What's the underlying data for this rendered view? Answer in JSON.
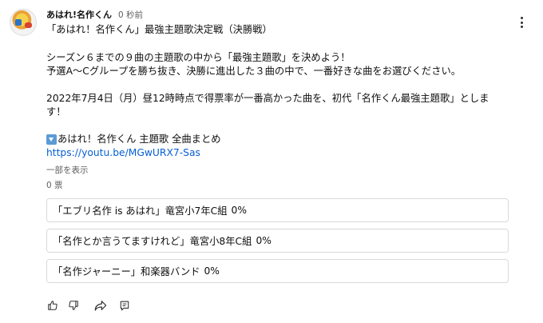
{
  "post": {
    "channel": "あはれ!名作くん",
    "time": "0 秒前",
    "title": "「あはれ！名作くん」最強主題歌決定戦（決勝戦）",
    "line1": "シーズン６までの９曲の主題歌の中から「最強主題歌」を決めよう！",
    "line2": "予選A〜Cグループを勝ち抜き、決勝に進出した３曲の中で、一番好きな曲をお選びください。",
    "line3": "2022年7月4日（月）昼12時時点で得票率が一番高かった曲を、初代「名作くん最強主題歌」としま",
    "line4": "す！",
    "line5": "あはれ！名作くん 主題歌 全曲まとめ",
    "link": "https://youtu.be/MGwURX7-Sas",
    "show_more": "一部を表示",
    "votes": "0 票"
  },
  "poll": {
    "options": [
      {
        "label": "「エブリ名作 is あはれ」竜宮小7年C組",
        "percent": "0%"
      },
      {
        "label": "「名作とか言うてますけれど」竜宮小8年C組",
        "percent": "0%"
      },
      {
        "label": "「名作ジャーニー」和楽器バンド",
        "percent": "0%"
      }
    ]
  },
  "icons": {
    "avatar": "channel-avatar",
    "more": "more-vertical-icon",
    "down_arrow": "down-arrow-emoji-icon",
    "like": "thumbs-up-icon",
    "dislike": "thumbs-down-icon",
    "share": "share-icon",
    "comment": "comment-icon"
  },
  "colors": {
    "link": "#065fd4",
    "secondary_text": "#606060",
    "option_border": "#d9d9d9",
    "down_arrow_bg": "#5b9bd5"
  }
}
